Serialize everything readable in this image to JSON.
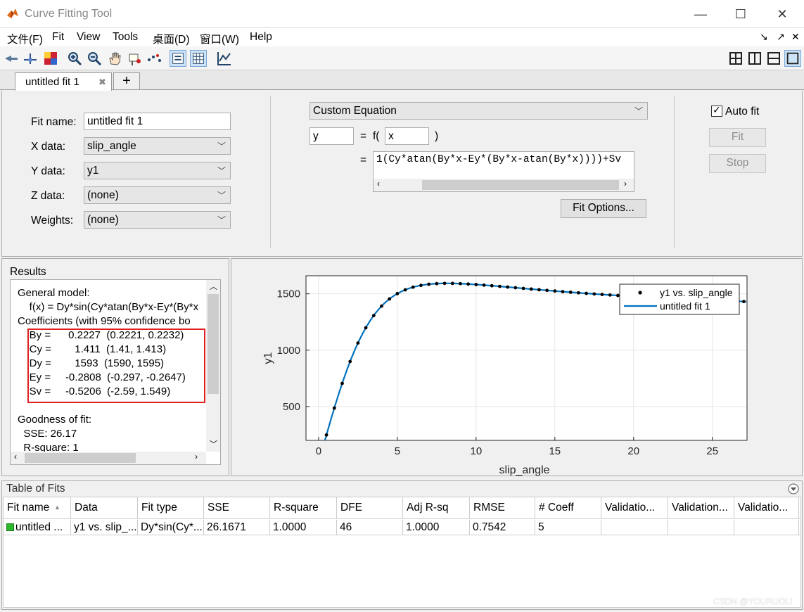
{
  "window": {
    "title": "Curve Fitting Tool",
    "minimize": "—",
    "maximize": "☐",
    "close": "✕"
  },
  "menu": [
    "文件(F)",
    "Fit",
    "View",
    "Tools",
    "桌面(D)",
    "窗口(W)",
    "Help"
  ],
  "tabs": [
    {
      "label": "untitled fit 1",
      "close": "✖"
    }
  ],
  "add_tab": "+",
  "fit_form": {
    "fit_name_label": "Fit name:",
    "fit_name_value": "untitled fit 1",
    "x_label": "X data:",
    "x_value": "slip_angle",
    "y_label": "Y data:",
    "y_value": "y1",
    "z_label": "Z data:",
    "z_value": "(none)",
    "w_label": "Weights:",
    "w_value": "(none)"
  },
  "equation": {
    "type": "Custom Equation",
    "dep_var": "y",
    "eq": "=",
    "f_open": "f(",
    "ind_var": "x",
    "f_close": ")",
    "eq2": "=",
    "expression": "1(Cy*atan(By*x-Ey*(By*x-atan(By*x))))+Sv",
    "fit_options": "Fit Options..."
  },
  "controls": {
    "auto_fit": "Auto fit",
    "auto_fit_checked": true,
    "fit": "Fit",
    "stop": "Stop"
  },
  "results": {
    "title": "Results",
    "lines": [
      "General model:",
      "    f(x) = Dy*sin(Cy*atan(By*x-Ey*(By*x",
      "Coefficients (with 95% confidence bo",
      "    By =      0.2227  (0.2221, 0.2232)",
      "    Cy =        1.411  (1.41, 1.413)",
      "    Dy =        1593  (1590, 1595)",
      "    Ey =     -0.2808  (-0.297, -0.2647)",
      "    Sv =     -0.5206  (-2.59, 1.549)",
      "",
      "Goodness of fit:",
      "  SSE: 26.17",
      "  R-square: 1"
    ]
  },
  "plot": {
    "legend": [
      "y1 vs. slip_angle",
      "untitled fit 1"
    ],
    "colors": {
      "fit": "#0072bd",
      "data": "#000000"
    }
  },
  "chart_data": {
    "type": "scatter",
    "title": "",
    "xlabel": "slip_angle",
    "ylabel": "y1",
    "xlim": [
      -0.8,
      27.2
    ],
    "ylim": [
      200,
      1660
    ],
    "xticks": [
      "0",
      "5",
      "10",
      "15",
      "20",
      "25"
    ],
    "yticks": [
      "500",
      "1000",
      "1500"
    ],
    "grid": true,
    "legend_position": "top-right",
    "coefficients": {
      "By": 0.2227,
      "Cy": 1.411,
      "Dy": 1593,
      "Ey": -0.2808,
      "Sv": -0.5206
    },
    "series": [
      {
        "name": "y1 vs. slip_angle",
        "kind": "points",
        "x": [
          0.5,
          1,
          1.5,
          2,
          2.5,
          3,
          3.5,
          4,
          4.5,
          5,
          5.5,
          6,
          6.5,
          7,
          7.5,
          8,
          8.5,
          9,
          9.5,
          10,
          10.5,
          11,
          11.5,
          12,
          12.5,
          13,
          13.5,
          14,
          14.5,
          15,
          15.5,
          16,
          16.5,
          17,
          17.5,
          18,
          18.5,
          19,
          19.5,
          20,
          20.5,
          21,
          21.5,
          22,
          22.5,
          23,
          23.5,
          24,
          24.5,
          25,
          25.5,
          26,
          26.5,
          27
        ]
      },
      {
        "name": "untitled fit 1",
        "kind": "curve",
        "x_range": [
          0.2,
          27.2
        ]
      }
    ]
  },
  "table": {
    "title": "Table of Fits",
    "headers": [
      "Fit name",
      "Data",
      "Fit type",
      "SSE",
      "R-square",
      "DFE",
      "Adj R-sq",
      "RMSE",
      "# Coeff",
      "Validatio...",
      "Validation...",
      "Validatio..."
    ],
    "rows": [
      [
        "untitled ...",
        "y1 vs. slip_...",
        "Dy*sin(Cy*...",
        "26.1671",
        "1.0000",
        "46",
        "1.0000",
        "0.7542",
        "5",
        "",
        "",
        ""
      ]
    ]
  },
  "watermark": "CSDN @YOURUOLI"
}
